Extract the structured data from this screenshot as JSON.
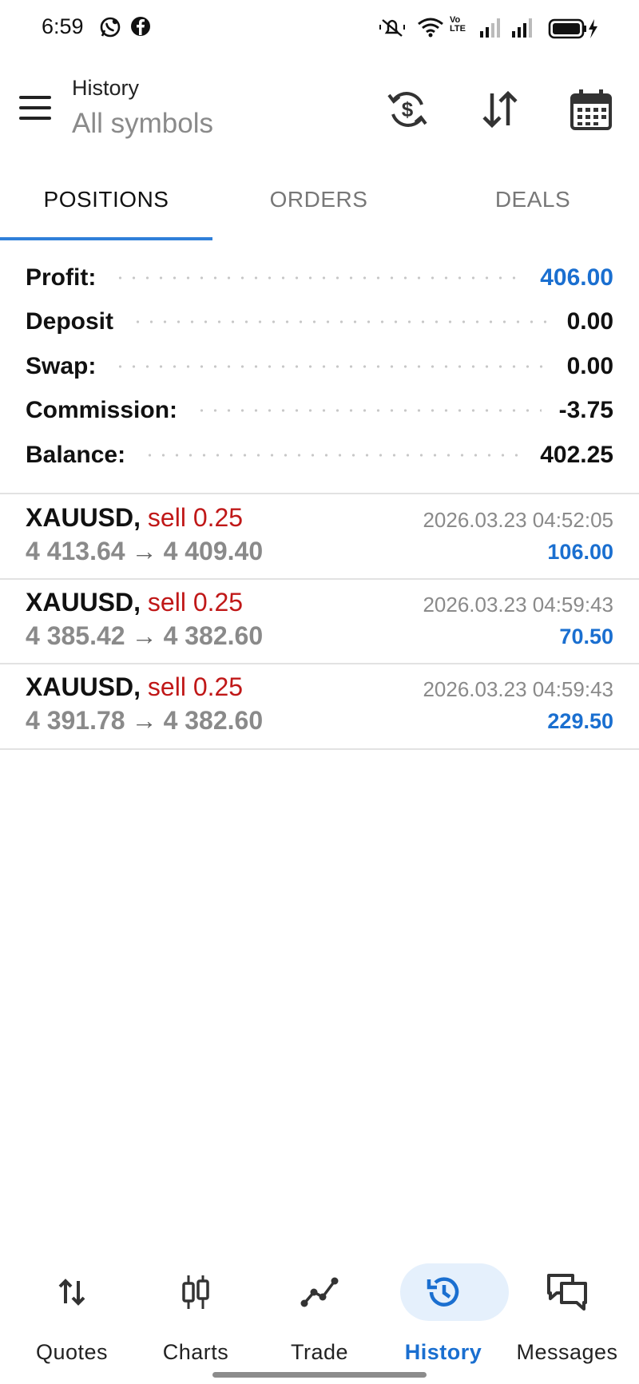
{
  "status_bar": {
    "time": "6:59",
    "left_icons": [
      "whatsapp-business-icon",
      "facebook-icon"
    ],
    "right_icons": [
      "silent-icon",
      "wifi-icon",
      "volte-icon",
      "signal-icon",
      "signal-icon",
      "battery-charging-icon"
    ],
    "volte_text": "Vo LTE"
  },
  "header": {
    "title": "History",
    "subtitle": "All symbols",
    "actions": [
      "currency-sync-icon",
      "sort-icon",
      "calendar-icon"
    ]
  },
  "tabs": [
    {
      "label": "POSITIONS",
      "active": true
    },
    {
      "label": "ORDERS",
      "active": false
    },
    {
      "label": "DEALS",
      "active": false
    }
  ],
  "summary": [
    {
      "label": "Profit:",
      "value": "406.00",
      "highlight": true
    },
    {
      "label": "Deposit",
      "value": "0.00",
      "highlight": false
    },
    {
      "label": "Swap:",
      "value": "0.00",
      "highlight": false
    },
    {
      "label": "Commission:",
      "value": "-3.75",
      "highlight": false
    },
    {
      "label": "Balance:",
      "value": "402.25",
      "highlight": false
    }
  ],
  "positions": [
    {
      "symbol": "XAUUSD,",
      "side": "sell 0.25",
      "open_price": "4 413.64",
      "arrow": "→",
      "close_price": "4 409.40",
      "time": "2026.03.23 04:52:05",
      "profit": "106.00"
    },
    {
      "symbol": "XAUUSD,",
      "side": "sell 0.25",
      "open_price": "4 385.42",
      "arrow": "→",
      "close_price": "4 382.60",
      "time": "2026.03.23 04:59:43",
      "profit": "70.50"
    },
    {
      "symbol": "XAUUSD,",
      "side": "sell 0.25",
      "open_price": "4 391.78",
      "arrow": "→",
      "close_price": "4 382.60",
      "time": "2026.03.23 04:59:43",
      "profit": "229.50"
    }
  ],
  "bottom_nav": [
    {
      "label": "Quotes",
      "icon": "quotes-arrows-icon",
      "active": false
    },
    {
      "label": "Charts",
      "icon": "candlestick-icon",
      "active": false
    },
    {
      "label": "Trade",
      "icon": "trend-line-icon",
      "active": false
    },
    {
      "label": "History",
      "icon": "history-clock-icon",
      "active": true
    },
    {
      "label": "Messages",
      "icon": "chat-bubbles-icon",
      "active": false
    }
  ],
  "colors": {
    "accent": "#1a6fd0",
    "sell": "#c01818",
    "muted": "#8a8a8a",
    "tab_indicator": "#2f7fd9"
  }
}
